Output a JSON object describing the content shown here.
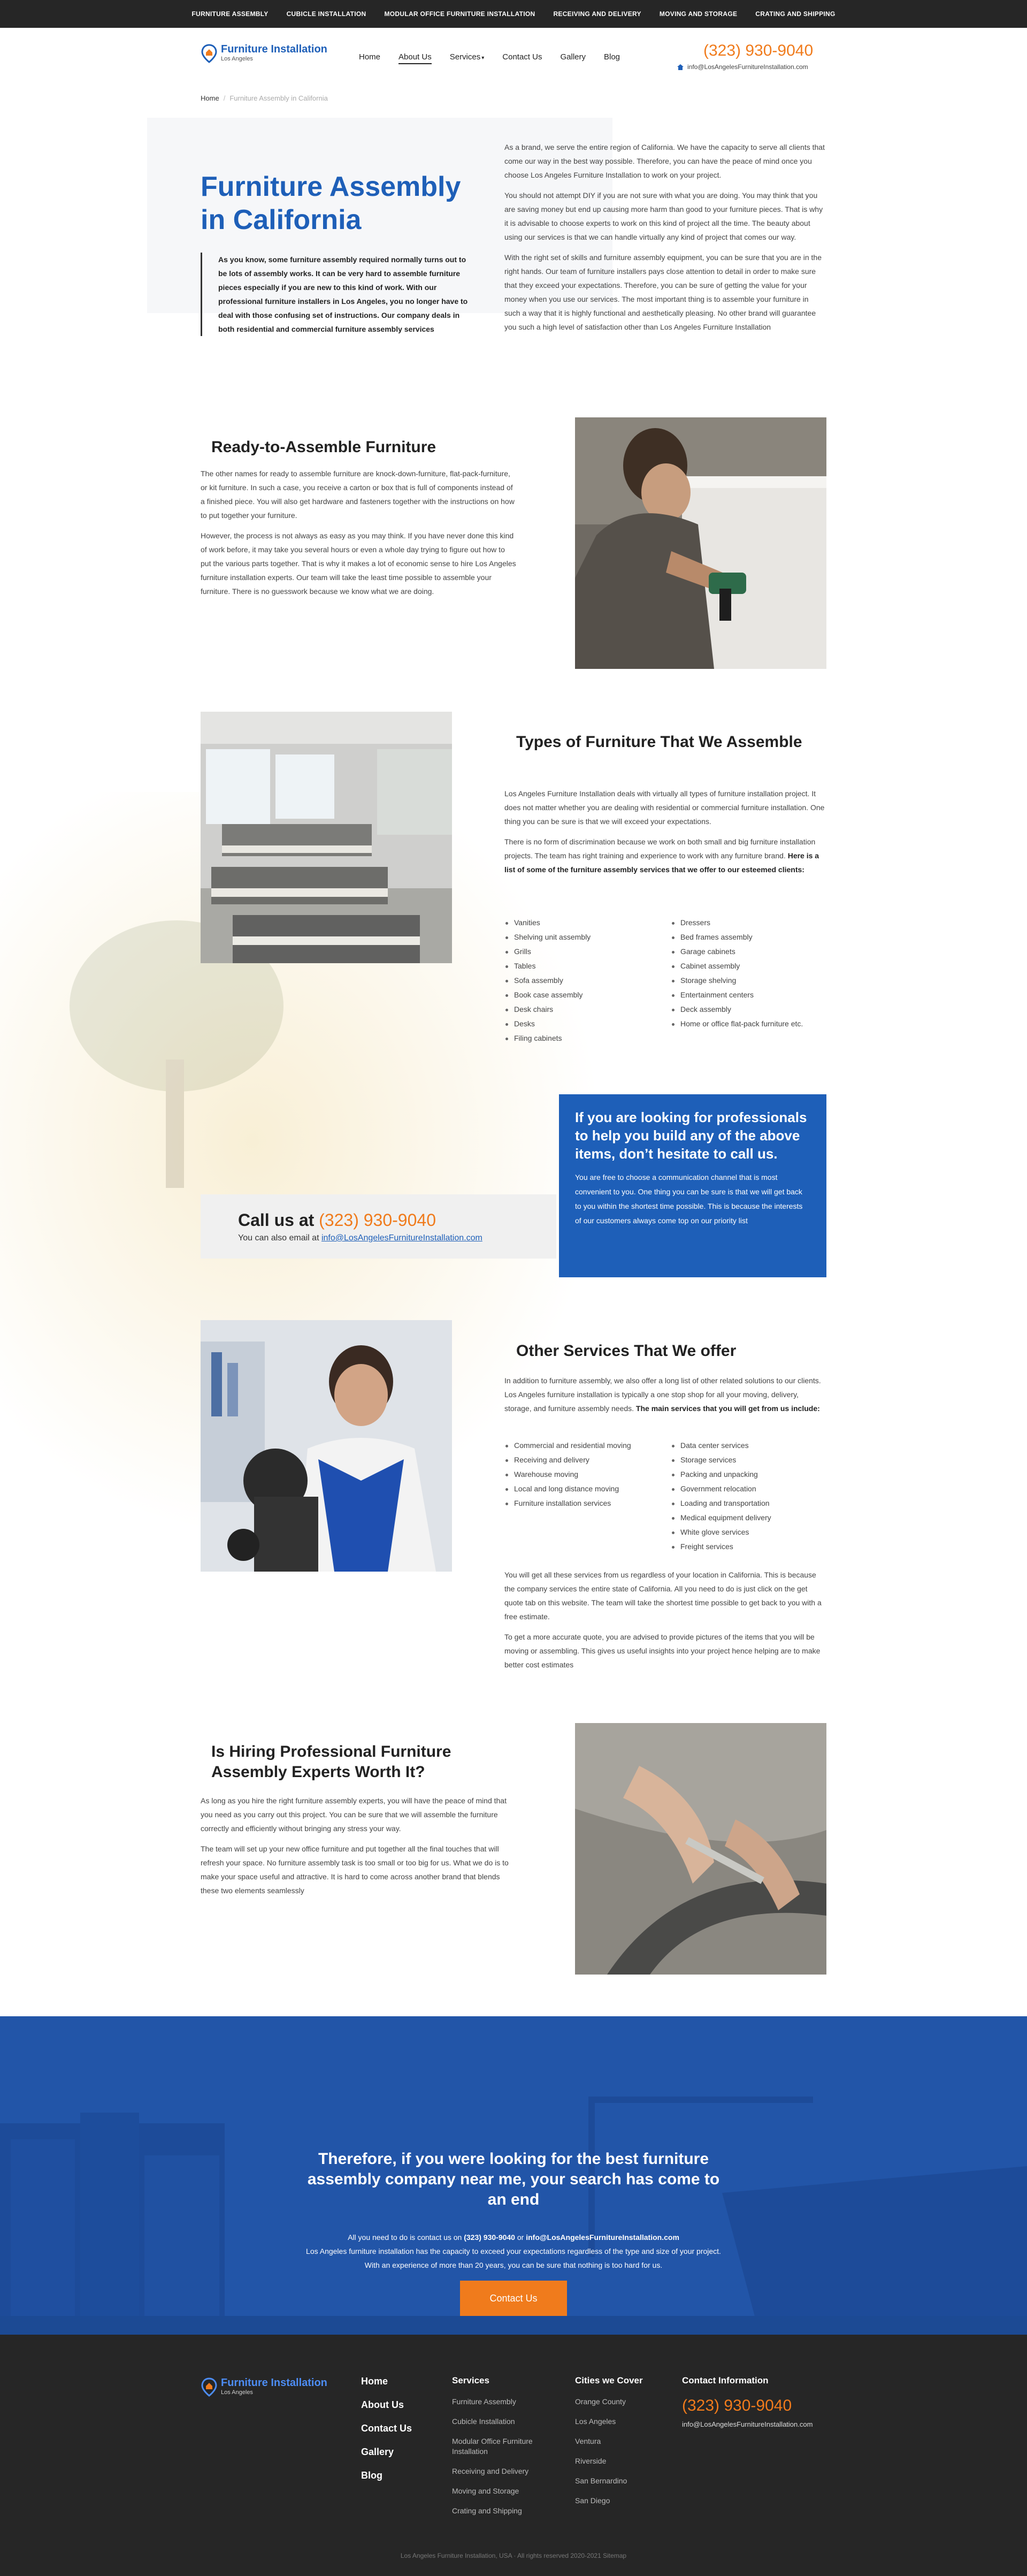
{
  "topbar": {
    "items": [
      "FURNITURE ASSEMBLY",
      "CUBICLE INSTALLATION",
      "MODULAR OFFICE FURNITURE INSTALLATION",
      "RECEIVING AND DELIVERY",
      "MOVING AND STORAGE",
      "CRATING AND SHIPPING"
    ]
  },
  "header": {
    "logo": {
      "name": "Furniture Installation",
      "sub": "Los Angeles",
      "icon": "location-pin-logo-icon"
    },
    "nav": [
      "Home",
      "About Us",
      "Services",
      "Contact Us",
      "Gallery",
      "Blog"
    ],
    "nav_active": "About Us",
    "services_caret": "▾",
    "phone": "(323) 930-9040",
    "email": "info@LosAngelesFurnitureInstallation.com"
  },
  "breadcrumb": {
    "home": "Home",
    "sep": "/",
    "current": "Furniture Assembly in California"
  },
  "hero": {
    "title": "Furniture Assembly in California",
    "quote": "As you know, some furniture assembly required normally turns out to be lots of assembly works. It can be very hard to assemble furniture pieces especially if you are new to this kind of work. With our professional furniture installers in Los Angeles, you no longer have to deal with those confusing set of instructions. Our company deals in both residential and commercial furniture assembly services",
    "paragraphs": [
      "As a brand, we serve the entire region of California. We have the capacity to serve all clients that come our way in the best way possible. Therefore, you can have the peace of mind once you choose Los Angeles Furniture Installation to work on your project.",
      "You should not attempt DIY if you are not sure with what you are doing. You may think that you are saving money but end up causing more harm than good to your furniture pieces. That is why it is advisable to choose experts to work on this kind of project all the time. The beauty about using our services is that we can handle virtually any kind of project that comes our way.",
      "With the right set of skills and furniture assembly equipment, you can be sure that you are in the right hands. Our team of furniture installers pays close attention to detail in order to make sure that they exceed your expectations. Therefore, you can be sure of getting the value for your money when you use our services. The most important thing is to assemble your furniture in such a way that it is highly functional and aesthetically pleasing. No other brand will guarantee you such a high level of satisfaction other than Los Angeles Furniture Installation"
    ]
  },
  "rta": {
    "title": "Ready-to-Assemble Furniture",
    "paragraphs": [
      "The other names for ready to assemble furniture are knock-down-furniture, flat-pack-furniture, or kit furniture. In such a case, you receive a carton or box that is full of components instead of a finished piece.  You will also get hardware and fasteners together with the instructions on how to put together your furniture.",
      "However, the process is not always as easy as you may think. If you have never done this kind of work before, it may take you several hours or even a whole day trying to figure out how to put the various parts together. That is why it makes a lot of economic sense to hire Los Angeles furniture installation experts. Our team will take the least time possible to assemble your furniture. There is no guesswork because we know what we are doing."
    ]
  },
  "types": {
    "title": "Types of Furniture That We Assemble",
    "p1": "Los Angeles Furniture Installation deals with virtually all types of furniture installation project. It does not matter whether you are dealing with residential or commercial furniture installation. One thing you can be sure is that we will exceed your expectations.",
    "p2": "There is no form of discrimination because we work on both small and big furniture installation projects. The team has right training and experience to work with any furniture brand.",
    "p2_bold": "Here is a list of some of the furniture assembly services that we offer to our esteemed clients:",
    "col1": [
      "Vanities",
      "Shelving unit assembly",
      "Grills",
      "Tables",
      "Sofa assembly",
      "Book case assembly",
      "Desk chairs",
      "Desks",
      "Filing cabinets"
    ],
    "col2": [
      "Dressers",
      "Bed frames assembly",
      "Garage cabinets",
      "Cabinet assembly",
      "Storage shelving",
      "Entertainment centers",
      "Deck assembly",
      "Home or office flat-pack furniture etc."
    ]
  },
  "call": {
    "label": "Call us at",
    "phone": "(323) 930-9040",
    "sub": "You can also email at",
    "email": "info@LosAngelesFurnitureInstallation.com"
  },
  "bluebox": {
    "title": "If you are looking for professionals to help you build any of the above items, don’t hesitate to call us.",
    "text": "You are free to choose a communication channel that is most convenient to you. One thing you can be sure is that we will get back to you within the shortest time possible. This is because the interests of our customers always come top on our priority list"
  },
  "other": {
    "title": "Other Services That We offer",
    "p1": "In addition to furniture assembly, we also offer a long list of other related solutions to our clients. Los Angeles furniture installation is typically a one stop shop for all your moving, delivery, storage, and furniture assembly needs.",
    "p1_bold": "The main services that you will get from us include:",
    "col1": [
      "Commercial and residential moving",
      "Receiving and delivery",
      "Warehouse moving",
      "Local and long distance moving",
      "Furniture installation services"
    ],
    "col2": [
      "Data center services",
      "Storage services",
      "Packing and unpacking",
      "Government relocation",
      "Loading and transportation",
      "Medical equipment delivery",
      "White glove services",
      "Freight services"
    ],
    "p2": "You will get all these services from us regardless of your location in California. This is because the company services the entire state of California. All you need to do is just click on the get quote tab on this website. The team will take the shortest time possible to get back to you with a free estimate.",
    "p3": "To get a more accurate quote, you are advised to provide pictures of the items that you will be moving or assembling. This gives us useful insights into your project hence helping are to make better cost estimates"
  },
  "hiring": {
    "title": "Is Hiring Professional Furniture Assembly Experts Worth It?",
    "paragraphs": [
      "As long as you hire the right furniture assembly experts, you will have the peace of mind that you need as you carry out this project. You can be sure that we will assemble the furniture correctly and efficiently without bringing any stress your way.",
      "The team will set up your new office furniture and put together all the final touches that will refresh your space. No furniture assembly task is too small or too big for us. What we do is to make your space useful and attractive. It is hard to come across another brand that blends these two elements seamlessly"
    ]
  },
  "cta": {
    "title": "Therefore, if you were looking for the best furniture assembly company near me, your search has come to an end",
    "t1": "All you need to do is contact us on",
    "phone": "(323) 930-9040",
    "t_or": "or",
    "email": "info@LosAngelesFurnitureInstallation.com",
    "t2": "Los Angeles furniture installation has the capacity to exceed your expectations regardless of the type and size of your project. With an experience of more than 20 years, you can be sure that nothing is too hard for us.",
    "button": "Contact Us"
  },
  "footer": {
    "logo": {
      "name": "Furniture Installation",
      "sub": "Los Angeles"
    },
    "main_links": [
      "Home",
      "About Us",
      "Contact Us",
      "Gallery",
      "Blog"
    ],
    "services_title": "Services",
    "services": [
      "Furniture Assembly",
      "Cubicle Installation",
      "Modular Office Furniture Installation",
      "Receiving and Delivery",
      "Moving and Storage",
      "Crating and Shipping"
    ],
    "cities_title": "Cities we Cover",
    "cities": [
      "Orange County",
      "Los Angeles",
      "Ventura",
      "Riverside",
      "San Bernardino",
      "San Diego"
    ],
    "contact_title": "Contact Information",
    "phone": "(323) 930-9040",
    "email": "info@LosAngelesFurnitureInstallation.com",
    "copyright": "Los Angeles Furniture Installation, USA · All rights reserved 2020-2021 Sitemap"
  },
  "colors": {
    "brand_blue": "#1e5fb8",
    "accent_orange": "#f07b1c",
    "dark": "#262626"
  }
}
